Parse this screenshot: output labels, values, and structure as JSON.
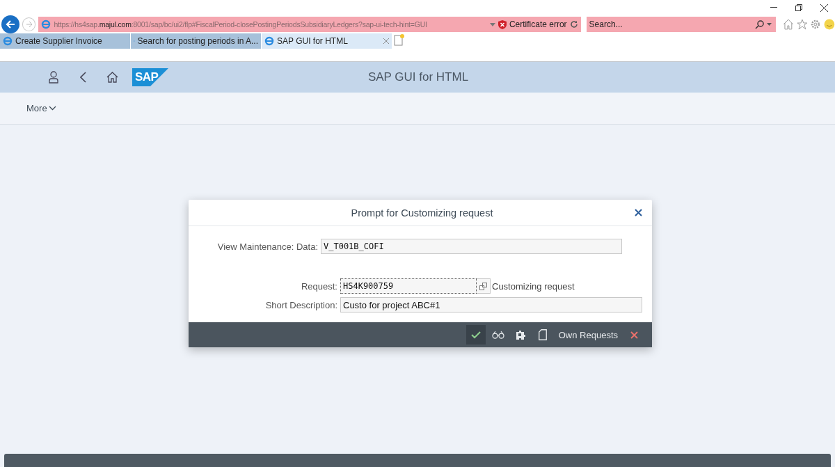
{
  "browser": {
    "url": [
      {
        "text": "https://hs4sap.",
        "emphasis": false
      },
      {
        "text": "majul.com",
        "emphasis": true
      },
      {
        "text": ":8001/sap/bc/ui2/flp#FiscalPeriod-closePostingPeriodsSubsidiaryLedgers?sap-ui-tech-hint=GUI",
        "emphasis": false
      }
    ],
    "certificate_error": "Certificate error",
    "search": {
      "placeholder": "Search..."
    },
    "tabs": [
      {
        "label": "Create Supplier Invoice",
        "selected": false
      },
      {
        "label": "Search for posting periods in A...",
        "selected": false
      },
      {
        "label": "SAP GUI for HTML",
        "selected": true
      }
    ]
  },
  "shell": {
    "title": "SAP GUI for HTML",
    "logo": "SAP"
  },
  "toolbar": {
    "more": "More"
  },
  "dialog": {
    "title": "Prompt for Customizing request",
    "fields": [
      {
        "label": "View Maintenance: Data:",
        "value": "V_T001B_COFI",
        "kind": "readonly"
      },
      {
        "label": "Request:",
        "value": "HS4K900759",
        "kind": "lookup",
        "hint": "Customizing request"
      },
      {
        "label": "Short Description:",
        "value": "Custo for project ABC#1",
        "kind": "text"
      }
    ],
    "own_requests": "Own Requests"
  }
}
